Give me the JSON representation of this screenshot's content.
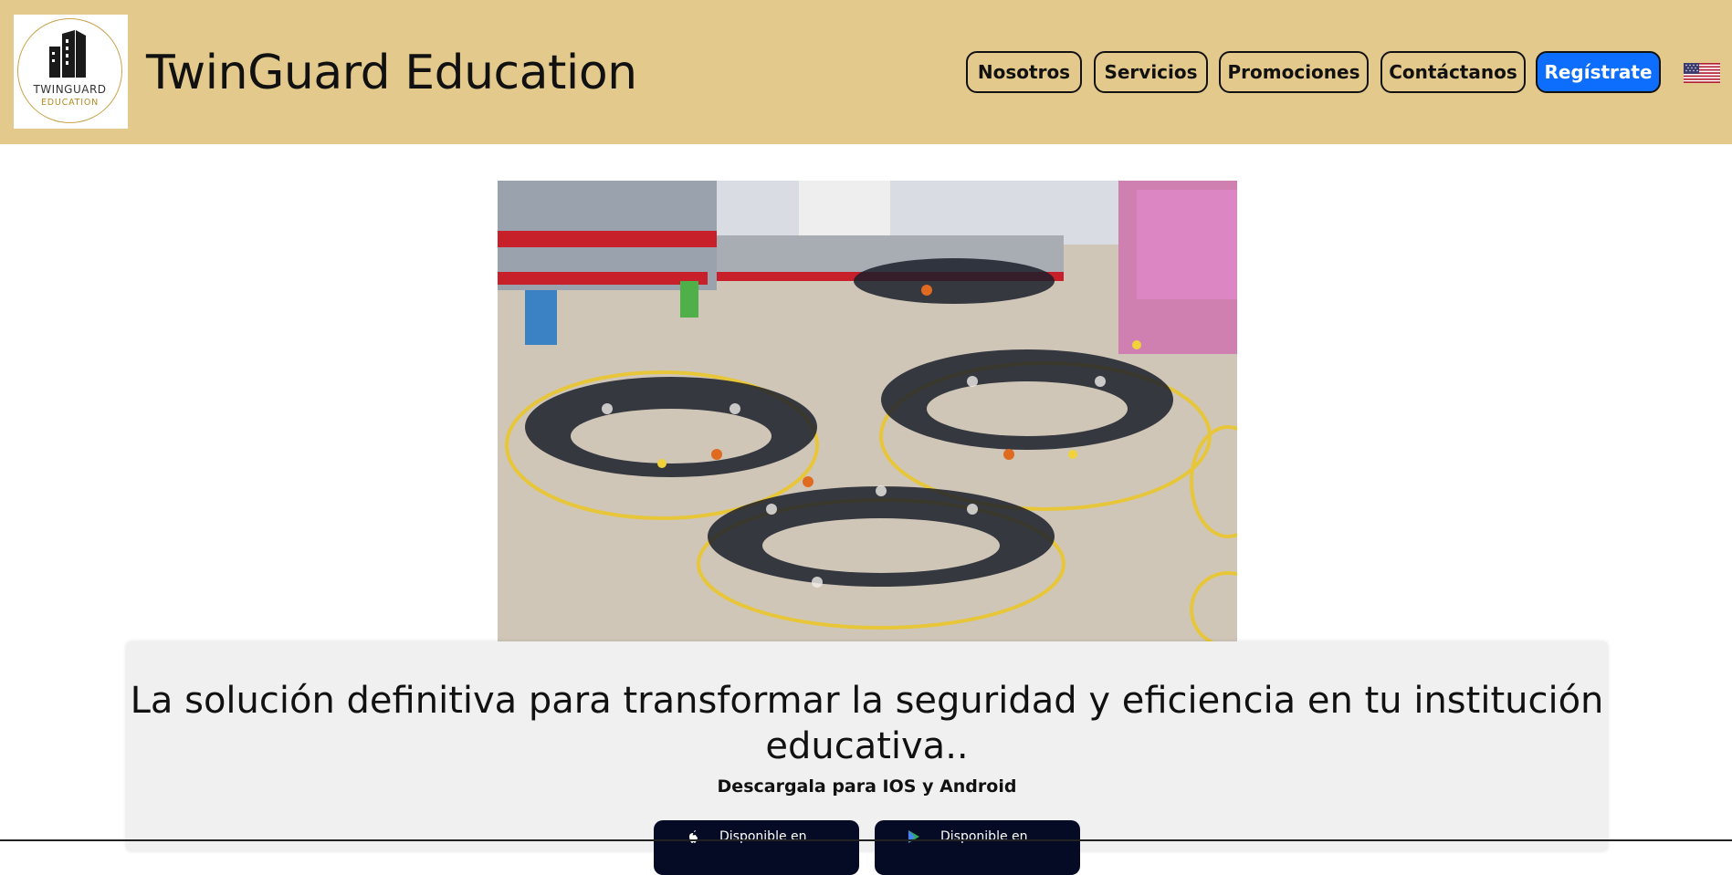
{
  "header": {
    "logo": {
      "line1": "TWINGUARD",
      "line2": "EDUCATION"
    },
    "brand": "TwinGuard Education",
    "nav": [
      {
        "label": "Nosotros"
      },
      {
        "label": "Servicios"
      },
      {
        "label": "Promociones"
      },
      {
        "label": "Contáctanos"
      },
      {
        "label": "Regístrate"
      }
    ],
    "language_flag": "us-flag-icon"
  },
  "hero": {
    "image": "students-in-schoolyard-circles"
  },
  "panel": {
    "headline": "La solución definitiva para transformar la seguridad y eficiencia en tu institución educativa..",
    "subline": "Descargala para IOS y Android",
    "stores": [
      {
        "label": "Disponible en",
        "icon": "apple-icon"
      },
      {
        "label": "Disponible en",
        "icon": "google-play-icon"
      }
    ]
  },
  "colors": {
    "header_bg": "#e3c98c",
    "primary_button": "#0d6efd",
    "store_button": "#050b24",
    "panel_bg": "#f0f0f0"
  }
}
